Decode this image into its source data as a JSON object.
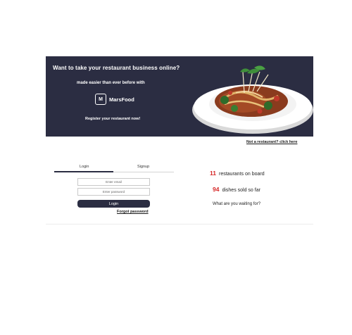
{
  "hero": {
    "title": "Want to take your restaurant business online?",
    "subtitle": "made easier than ever before with",
    "brand_logo": "M",
    "brand_name": "MarsFood",
    "register_text": "Register your restaurant now!",
    "image": "dish-image",
    "bg_color": "#2b2d42"
  },
  "not_restaurant_link": "Not a restaurant? click here",
  "auth": {
    "tabs": [
      {
        "label": "Login",
        "active": true
      },
      {
        "label": "Signup",
        "active": false
      }
    ],
    "email_placeholder": "Enter email",
    "password_placeholder": "Enter password",
    "login_button": "Login",
    "forgot_link": "Forgot password"
  },
  "stats": {
    "restaurants_count": "11",
    "restaurants_label": "restaurants on board",
    "dishes_count": "94",
    "dishes_label": "dishes sold so far",
    "cta": "What are you waiting for?",
    "accent_color": "#d62828"
  }
}
